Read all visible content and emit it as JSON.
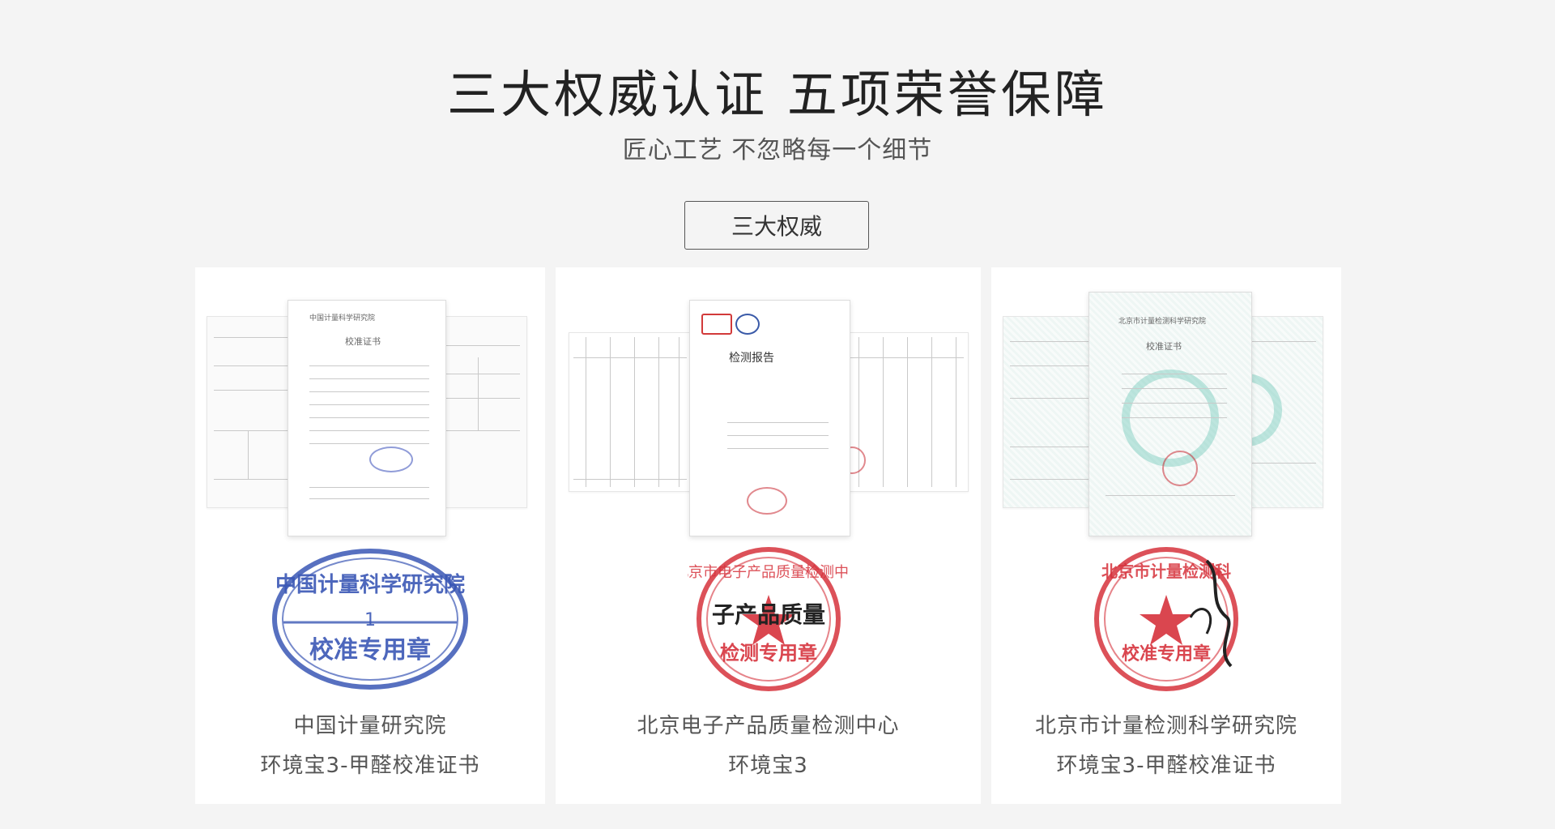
{
  "header": {
    "title": "三大权威认证   五项荣誉保障",
    "subtitle": "匠心工艺 不忽略每一个细节"
  },
  "tab": {
    "label": "三大权威"
  },
  "cards": [
    {
      "line1": "中国计量研究院",
      "line2": "环境宝3-甲醛校准证书",
      "seal": {
        "color": "#3a57b5",
        "top_text": "中国计量科学研究院",
        "middle_text": "1",
        "bottom_text": "校准专用章"
      },
      "doc_title": "中国计量科学研究院",
      "doc_heading": "校准证书"
    },
    {
      "line1": "北京电子产品质量检测中心",
      "line2": "环境宝3",
      "seal": {
        "color": "#d6323c",
        "top_text": "北京市电子产品质量检测中心",
        "middle_text": "子产品质量",
        "bottom_text": "检测专用章"
      },
      "doc_heading": "检测报告"
    },
    {
      "line1": "北京市计量检测科学研究院",
      "line2": "环境宝3-甲醛校准证书",
      "seal": {
        "color": "#d6323c",
        "top_text": "北京市计量检测科",
        "bottom_text": "校准专用章"
      },
      "doc_title": "北京市计量检测科学研究院",
      "doc_heading": "校准证书"
    }
  ]
}
